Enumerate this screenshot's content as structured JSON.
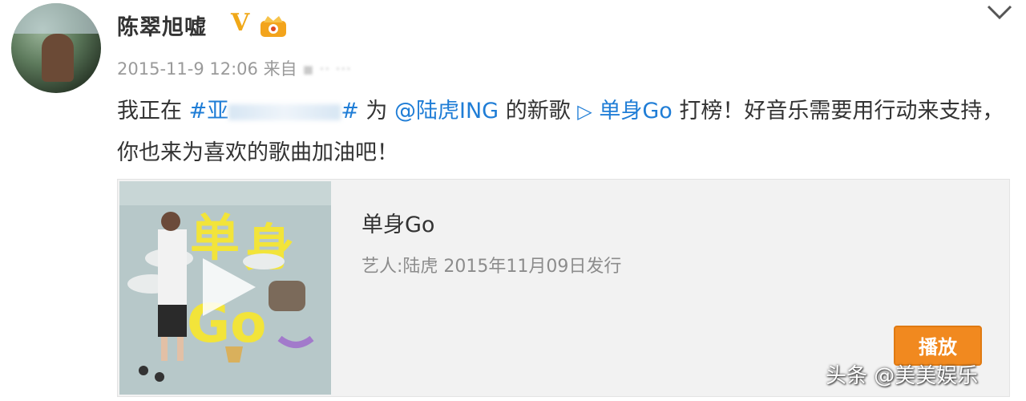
{
  "header": {
    "username": "陈翠旭嘘",
    "verified_badge": "V",
    "crown_badge_icon": "crown-badge-icon",
    "menu_icon": "chevron-down-icon"
  },
  "meta": {
    "timestamp": "2015-11-9 12:06",
    "source_prefix": "来自",
    "source_blurred": "▪ ·· ···"
  },
  "post": {
    "part1": "我正在 ",
    "hashtag_start": "#亚",
    "hashtag_end": "#",
    "part2": " 为 ",
    "mention": "@陆虎ING",
    "part3": " 的新歌  ",
    "play_glyph": "▷",
    "song_link": " 单身Go",
    "part4": " 打榜！好音乐需要用行动来支持，你也来为喜欢的歌曲加油吧！"
  },
  "card": {
    "song_title": "单身Go",
    "song_meta": "艺人:陆虎 2015年11月09日发行",
    "play_button": "播放",
    "cover_art_icon": "album-cover-icon",
    "cover_play_icon": "play-icon"
  },
  "watermark": "头条 @美美娱乐",
  "colors": {
    "link": "#1f7dd6",
    "verified": "#f0a818",
    "play_button": "#f1891f"
  }
}
